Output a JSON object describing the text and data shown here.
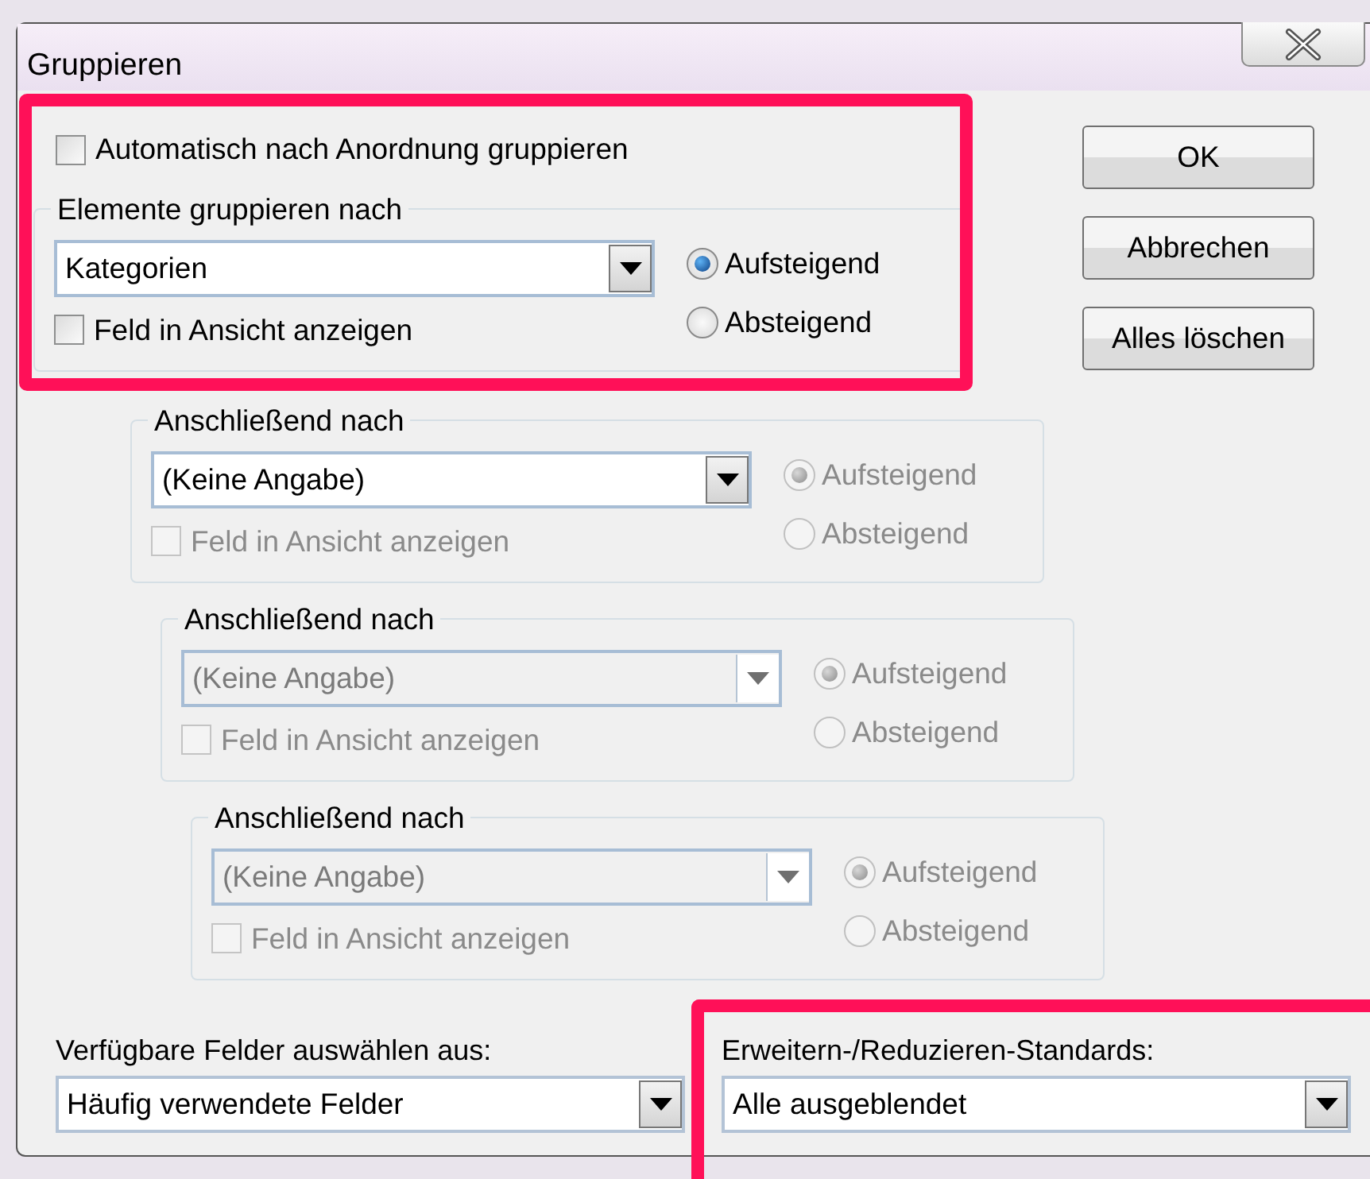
{
  "window": {
    "title": "Gruppieren"
  },
  "auto_group": {
    "label": "Automatisch nach Anordnung gruppieren",
    "checked": false,
    "highlighted": true
  },
  "groups": [
    {
      "legend": "Elemente gruppieren nach",
      "dropdown": {
        "value": "Kategorien",
        "disabled": false
      },
      "show_field": {
        "label": "Feld in Ansicht anzeigen",
        "checked": false,
        "disabled": false
      },
      "order": [
        {
          "label": "Aufsteigend",
          "selected": true,
          "disabled": false
        },
        {
          "label": "Absteigend",
          "selected": false,
          "disabled": false
        }
      ]
    },
    {
      "legend": "Anschließend nach",
      "dropdown": {
        "value": "(Keine Angabe)",
        "disabled": false
      },
      "show_field": {
        "label": "Feld in Ansicht anzeigen",
        "checked": false,
        "disabled": true
      },
      "order": [
        {
          "label": "Aufsteigend",
          "selected": true,
          "disabled": true
        },
        {
          "label": "Absteigend",
          "selected": false,
          "disabled": true
        }
      ]
    },
    {
      "legend": "Anschließend nach",
      "dropdown": {
        "value": "(Keine Angabe)",
        "disabled": true
      },
      "show_field": {
        "label": "Feld in Ansicht anzeigen",
        "checked": false,
        "disabled": true
      },
      "order": [
        {
          "label": "Aufsteigend",
          "selected": true,
          "disabled": true
        },
        {
          "label": "Absteigend",
          "selected": false,
          "disabled": true
        }
      ]
    },
    {
      "legend": "Anschließend nach",
      "dropdown": {
        "value": "(Keine Angabe)",
        "disabled": true
      },
      "show_field": {
        "label": "Feld in Ansicht anzeigen",
        "checked": false,
        "disabled": true
      },
      "order": [
        {
          "label": "Aufsteigend",
          "selected": true,
          "disabled": true
        },
        {
          "label": "Absteigend",
          "selected": false,
          "disabled": true
        }
      ]
    }
  ],
  "buttons": [
    "OK",
    "Abbrechen",
    "Alles löschen"
  ],
  "available_fields": {
    "label": "Verfügbare Felder auswählen aus:",
    "value": "Häufig verwendete Felder"
  },
  "expand_defaults": {
    "label": "Erweitern-/Reduzieren-Standards:",
    "value": "Alle ausgeblendet",
    "highlighted": true
  }
}
